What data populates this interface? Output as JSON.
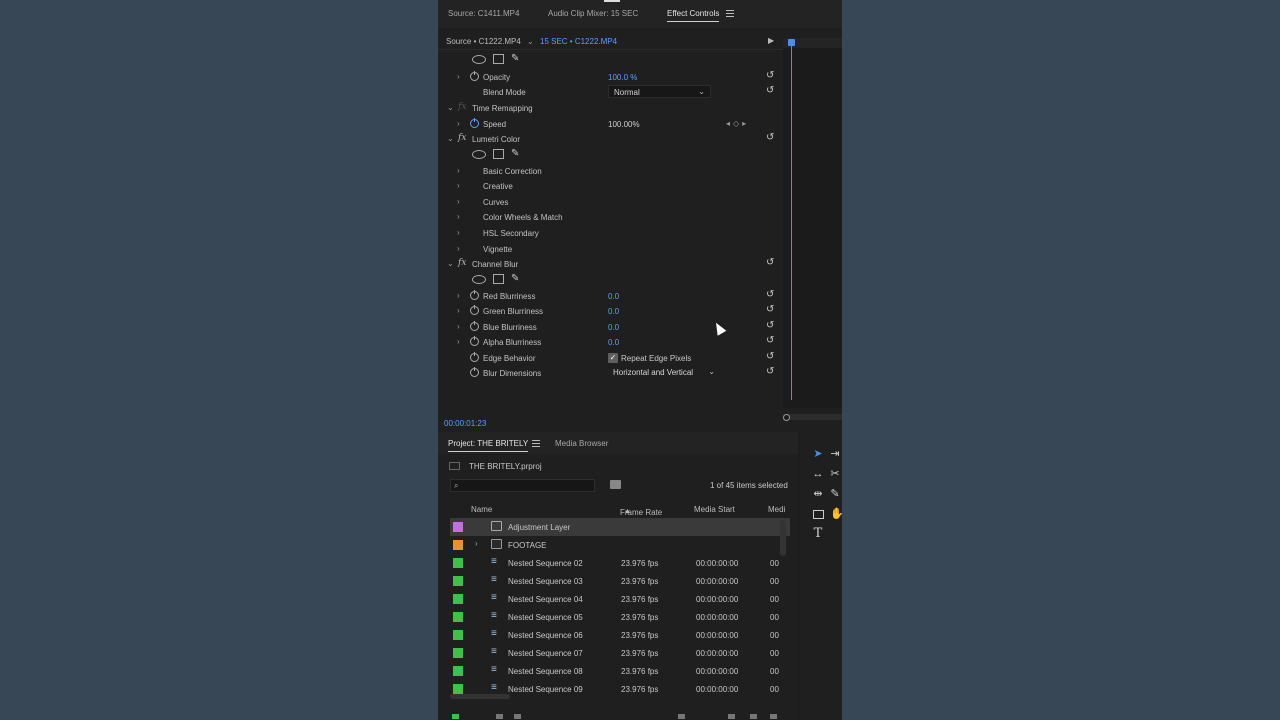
{
  "top_tabs": [
    {
      "label": "Source: C1411.MP4"
    },
    {
      "label": "Audio Clip Mixer: 15 SEC"
    },
    {
      "label": "Effect Controls"
    }
  ],
  "effect_controls": {
    "source_label": "Source • C1222.MP4",
    "clip_label": "15 SEC • C1222.MP4",
    "timecode": "00:00:01:23",
    "opacity": {
      "label": "Opacity",
      "value": "100.0 %"
    },
    "blend_mode": {
      "label": "Blend Mode",
      "value": "Normal"
    },
    "time_remapping": {
      "label": "Time Remapping"
    },
    "speed": {
      "label": "Speed",
      "value": "100.00%"
    },
    "lumetri": {
      "label": "Lumetri Color",
      "sections": [
        "Basic Correction",
        "Creative",
        "Curves",
        "Color Wheels & Match",
        "HSL Secondary",
        "Vignette"
      ]
    },
    "channel_blur": {
      "label": "Channel Blur",
      "params": [
        {
          "label": "Red Blurriness",
          "value": "0.0"
        },
        {
          "label": "Green Blurriness",
          "value": "0.0"
        },
        {
          "label": "Blue Blurriness",
          "value": "0.0"
        },
        {
          "label": "Alpha Blurriness",
          "value": "0.0"
        }
      ],
      "edge_behavior": {
        "label": "Edge Behavior",
        "checkbox_label": "Repeat Edge Pixels",
        "checked": true
      },
      "blur_dimensions": {
        "label": "Blur Dimensions",
        "value": "Horizontal and Vertical"
      }
    }
  },
  "project": {
    "tabs": [
      {
        "label": "Project: THE BRITELY"
      },
      {
        "label": "Media Browser"
      }
    ],
    "file": "THE BRITELY.prproj",
    "selection_count": "1 of 45 items selected",
    "columns": {
      "name": "Name",
      "frame_rate": "Frame Rate",
      "media_start": "Media Start",
      "media_end": "Medi"
    },
    "items": [
      {
        "name": "Adjustment Layer",
        "frame_rate": "",
        "media_start": "",
        "media_end": "",
        "color": "#c46fe0",
        "type": "adjustment",
        "selected": true
      },
      {
        "name": "FOOTAGE",
        "frame_rate": "",
        "media_start": "",
        "media_end": "",
        "color": "#e8912d",
        "type": "folder",
        "selected": false
      },
      {
        "name": "Nested Sequence 02",
        "frame_rate": "23.976 fps",
        "media_start": "00:00:00:00",
        "media_end": "00",
        "color": "#3cc14a",
        "type": "sequence",
        "selected": false
      },
      {
        "name": "Nested Sequence 03",
        "frame_rate": "23.976 fps",
        "media_start": "00:00:00:00",
        "media_end": "00",
        "color": "#3cc14a",
        "type": "sequence",
        "selected": false
      },
      {
        "name": "Nested Sequence 04",
        "frame_rate": "23.976 fps",
        "media_start": "00:00:00:00",
        "media_end": "00",
        "color": "#3cc14a",
        "type": "sequence",
        "selected": false
      },
      {
        "name": "Nested Sequence 05",
        "frame_rate": "23.976 fps",
        "media_start": "00:00:00:00",
        "media_end": "00",
        "color": "#3cc14a",
        "type": "sequence",
        "selected": false
      },
      {
        "name": "Nested Sequence 06",
        "frame_rate": "23.976 fps",
        "media_start": "00:00:00:00",
        "media_end": "00",
        "color": "#3cc14a",
        "type": "sequence",
        "selected": false
      },
      {
        "name": "Nested Sequence 07",
        "frame_rate": "23.976 fps",
        "media_start": "00:00:00:00",
        "media_end": "00",
        "color": "#3cc14a",
        "type": "sequence",
        "selected": false
      },
      {
        "name": "Nested Sequence 08",
        "frame_rate": "23.976 fps",
        "media_start": "00:00:00:00",
        "media_end": "00",
        "color": "#3cc14a",
        "type": "sequence",
        "selected": false
      },
      {
        "name": "Nested Sequence 09",
        "frame_rate": "23.976 fps",
        "media_start": "00:00:00:00",
        "media_end": "00",
        "color": "#3cc14a",
        "type": "sequence",
        "selected": false
      }
    ]
  },
  "tools": [
    "selection-tool-icon",
    "track-select-icon",
    "ripple-edit-icon",
    "razor-icon",
    "slip-icon",
    "pen-icon",
    "rectangle-icon",
    "hand-icon",
    "type-icon"
  ],
  "colors": {
    "accent": "#4a90e2",
    "value_blue": "#5aa0ff"
  }
}
